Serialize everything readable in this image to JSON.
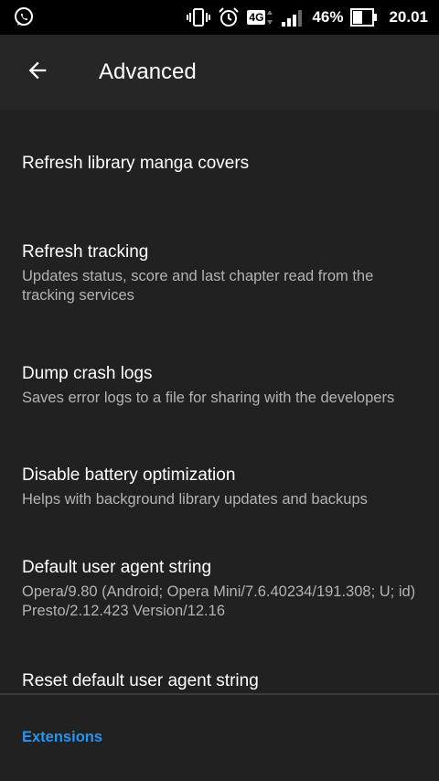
{
  "status_bar": {
    "battery_percent": "46%",
    "time": "20.01",
    "network": "4G",
    "icons": [
      "whatsapp-icon",
      "vibrate-icon",
      "alarm-icon",
      "network-4g-icon",
      "signal-icon",
      "battery-icon"
    ]
  },
  "toolbar": {
    "title": "Advanced",
    "back_icon": "arrow-back-icon"
  },
  "preferences": [
    {
      "title": "Refresh library manga covers",
      "summary": ""
    },
    {
      "title": "Refresh tracking",
      "summary": "Updates status, score and last chapter read from the tracking services"
    },
    {
      "title": "Dump crash logs",
      "summary": "Saves error logs to a file for sharing with the developers"
    },
    {
      "title": "Disable battery optimization",
      "summary": "Helps with background library updates and backups"
    },
    {
      "title": "Default user agent string",
      "summary": "Opera/9.80 (Android; Opera Mini/7.6.40234/191.308; U; id) Presto/2.12.423 Version/12.16"
    },
    {
      "title": "Reset default user agent string",
      "summary": ""
    }
  ],
  "section": {
    "extensions_label": "Extensions"
  },
  "colors": {
    "background": "#212121",
    "toolbar": "#262626",
    "accent": "#2196f3",
    "summary_text": "#b3b3b3"
  }
}
